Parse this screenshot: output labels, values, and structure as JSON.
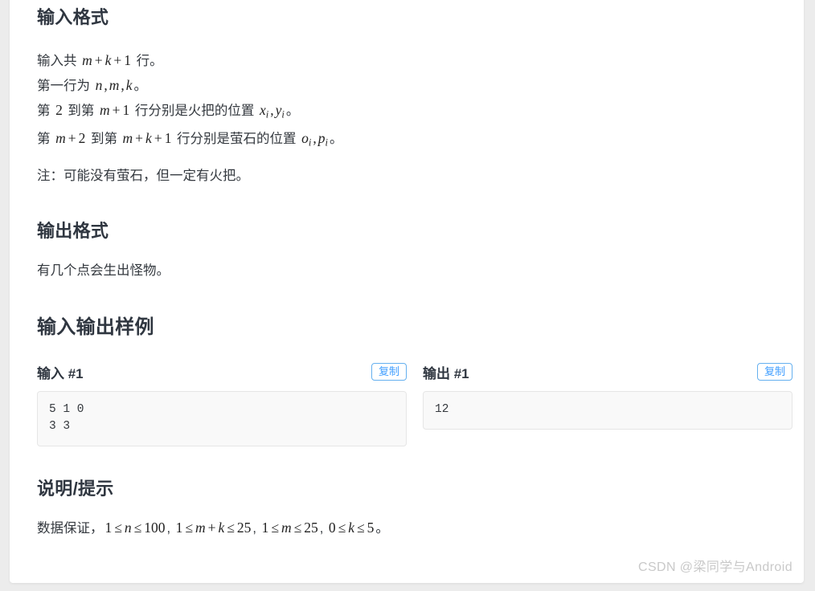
{
  "page": {
    "background_color": "#ececec",
    "card_color": "#ffffff",
    "heading_color": "#2f3640",
    "text_color": "#34393f",
    "accent_color": "#409eff"
  },
  "sections": {
    "input_format": {
      "heading": "输入格式",
      "lines": [
        {
          "segments": [
            {
              "type": "text",
              "value": "输入共 "
            },
            {
              "type": "math",
              "value": "m + k + 1"
            },
            {
              "type": "text",
              "value": " 行。"
            }
          ],
          "plain": "输入共 m + k + 1 行。"
        },
        {
          "segments": [
            {
              "type": "text",
              "value": "第一行为 "
            },
            {
              "type": "math",
              "value": "n, m, k"
            },
            {
              "type": "text",
              "value": "。"
            }
          ],
          "plain": "第一行为 n, m, k。"
        },
        {
          "segments": [
            {
              "type": "text",
              "value": "第 "
            },
            {
              "type": "math",
              "value": "2"
            },
            {
              "type": "text",
              "value": " 到第 "
            },
            {
              "type": "math",
              "value": "m + 1"
            },
            {
              "type": "text",
              "value": " 行分别是火把的位置 "
            },
            {
              "type": "math",
              "value": "x_i, y_i"
            },
            {
              "type": "text",
              "value": "。"
            }
          ],
          "plain": "第 2 到第 m + 1 行分别是火把的位置 x_i, y_i。"
        },
        {
          "segments": [
            {
              "type": "text",
              "value": "第 "
            },
            {
              "type": "math",
              "value": "m + 2"
            },
            {
              "type": "text",
              "value": " 到第 "
            },
            {
              "type": "math",
              "value": "m + k + 1"
            },
            {
              "type": "text",
              "value": " 行分别是萤石的位置 "
            },
            {
              "type": "math",
              "value": "o_i, p_i"
            },
            {
              "type": "text",
              "value": "。"
            }
          ],
          "plain": "第 m + 2 到第 m + k + 1 行分别是萤石的位置 o_i, p_i。"
        }
      ],
      "note": "注：可能没有萤石，但一定有火把。"
    },
    "output_format": {
      "heading": "输出格式",
      "text": "有几个点会生出怪物。"
    },
    "samples": {
      "heading": "输入输出样例",
      "items": [
        {
          "title": "输入 #1",
          "copy_label": "复制",
          "code": "5 1 0\n3 3"
        },
        {
          "title": "输出 #1",
          "copy_label": "复制",
          "code": "12"
        }
      ]
    },
    "hint": {
      "heading": "说明/提示",
      "text_prefix": "数据保证，",
      "constraints": [
        "1 ≤ n ≤ 100",
        "1 ≤ m + k ≤ 25",
        "1 ≤ m ≤ 25",
        "0 ≤ k ≤ 5"
      ],
      "text_suffix": "。",
      "plain": "数据保证，1 ≤ n ≤ 100, 1 ≤ m + k ≤ 25, 1 ≤ m ≤ 25, 0 ≤ k ≤ 5。"
    }
  },
  "watermark": {
    "text": "CSDN @梁同学与Android"
  }
}
